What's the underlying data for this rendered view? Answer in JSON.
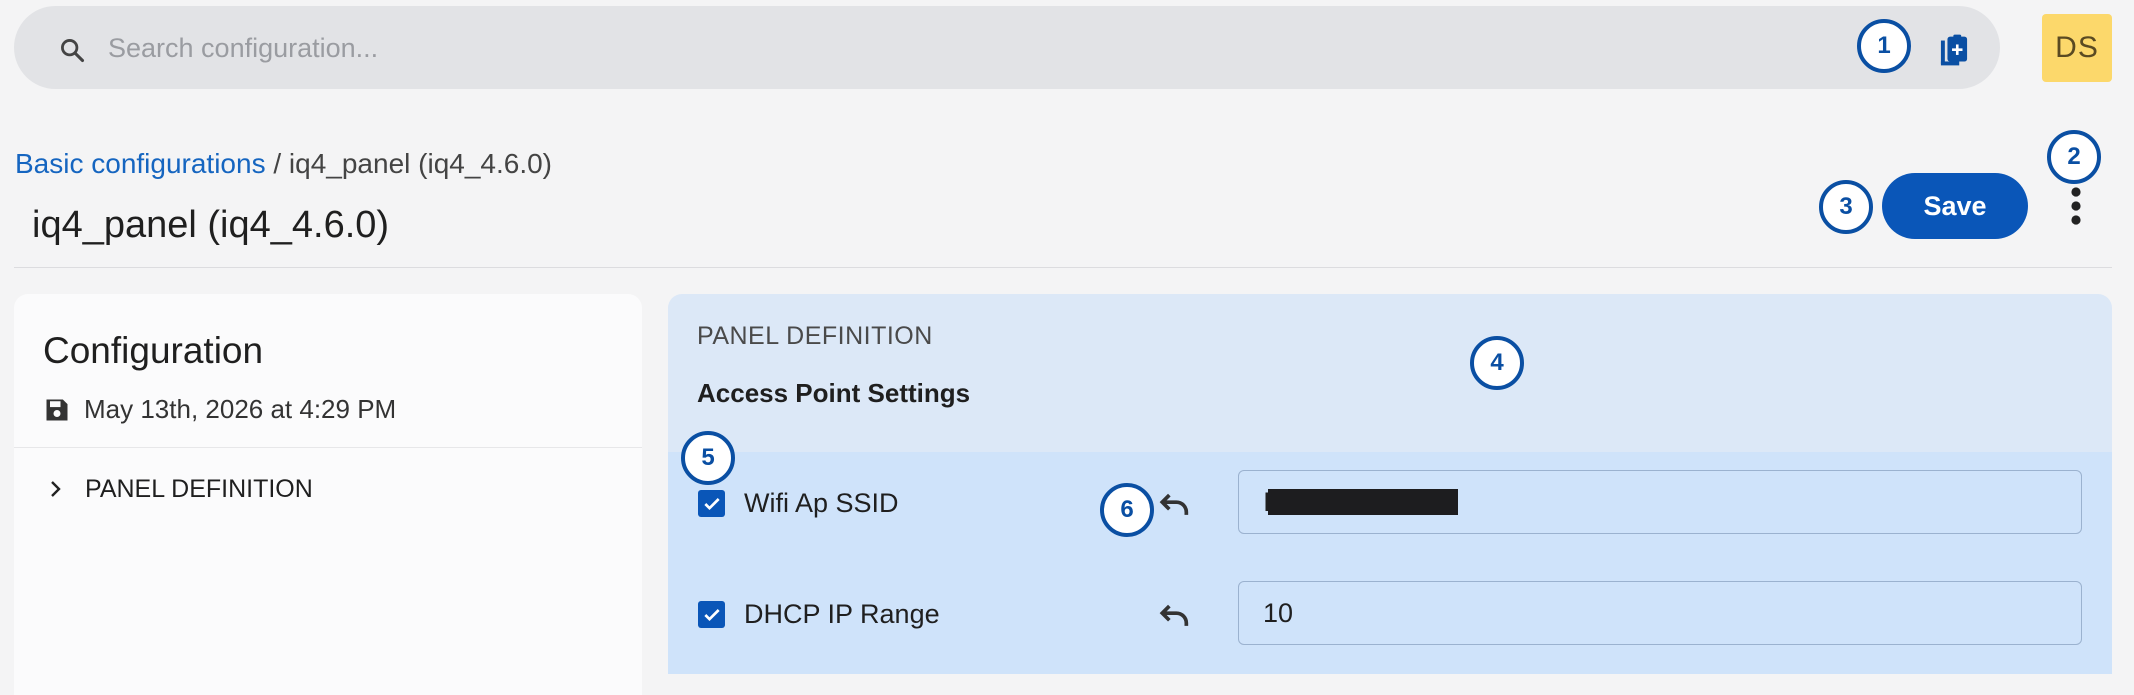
{
  "search": {
    "placeholder": "Search configuration...",
    "value": ""
  },
  "user": {
    "initials": "DS"
  },
  "markers": [
    "1",
    "2",
    "3",
    "4",
    "5",
    "6"
  ],
  "breadcrumb": {
    "parent": "Basic configurations",
    "separator": " / ",
    "current": "iq4_panel (iq4_4.6.0)"
  },
  "page": {
    "title": "iq4_panel (iq4_4.6.0)",
    "save_label": "Save"
  },
  "sidebar": {
    "title": "Configuration",
    "saved_at": "May 13th, 2026 at 4:29 PM",
    "items": [
      {
        "label": "PANEL DEFINITION"
      }
    ]
  },
  "panel": {
    "heading": "PANEL DEFINITION",
    "subheading": "Access Point Settings",
    "rows": [
      {
        "label": "Wifi Ap SSID",
        "value": "I1",
        "checked": true
      },
      {
        "label": "DHCP IP Range",
        "value": "10",
        "checked": true
      }
    ]
  },
  "colors": {
    "accent": "#0a56b8",
    "marker": "#0a4fa3",
    "avatar_bg": "#fcd86b",
    "panel_bg": "#dce8f7",
    "settings_bg": "#cfe3fa"
  }
}
